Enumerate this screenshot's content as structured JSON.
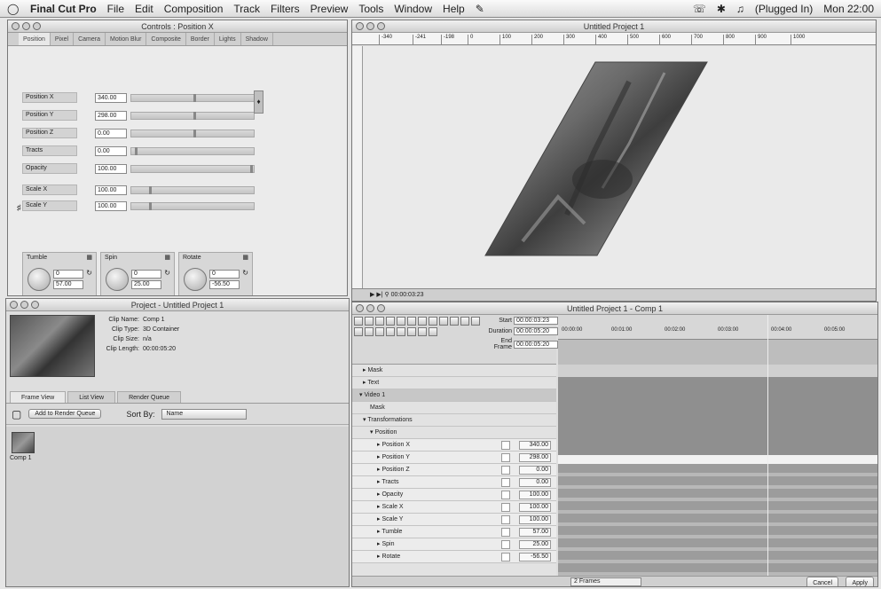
{
  "menubar": {
    "app": "Final Cut Pro",
    "items": [
      "File",
      "Edit",
      "Composition",
      "Track",
      "Filters",
      "Preview",
      "Tools",
      "Window",
      "Help"
    ],
    "status": "(Plugged In)",
    "clock": "Mon 22:00"
  },
  "controls": {
    "title": "Controls : Position X",
    "tabs": [
      "Position",
      "Pixel",
      "Camera",
      "Motion Blur",
      "Composite",
      "Border",
      "Lights",
      "Shadow"
    ],
    "params": [
      {
        "label": "Position X",
        "value": "340.00"
      },
      {
        "label": "Position Y",
        "value": "298.00"
      },
      {
        "label": "Position Z",
        "value": "0.00"
      },
      {
        "label": "Tracts",
        "value": "0.00"
      },
      {
        "label": "Opacity",
        "value": "100.00"
      },
      {
        "label": "Scale X",
        "value": "100.00"
      },
      {
        "label": "Scale Y",
        "value": "100.00"
      }
    ],
    "dials": [
      {
        "label": "Tumble",
        "v1": "0",
        "v2": "57.00"
      },
      {
        "label": "Spin",
        "v1": "0",
        "v2": "25.00"
      },
      {
        "label": "Rotate",
        "v1": "0",
        "v2": "-56.50"
      }
    ]
  },
  "canvas": {
    "title": "Untitled Project 1",
    "ruler": [
      "-340",
      "-241",
      "-198",
      "0",
      "100",
      "200",
      "300",
      "400",
      "500",
      "600",
      "700",
      "800",
      "900",
      "1000"
    ],
    "timecode": "00:00:03:23"
  },
  "project": {
    "title": "Project - Untitled Project 1",
    "clip_keys": [
      "Clip Name:",
      "Clip Type:",
      "Clip Size:",
      "Clip Length:"
    ],
    "clip_values": [
      "Comp 1",
      "3D Container",
      "n/a",
      "00:00:05:20"
    ],
    "tabs": [
      "Frame View",
      "List View",
      "Render Queue"
    ],
    "add_button": "Add to Render Queue",
    "sort_label": "Sort By:",
    "sort_value": "Name",
    "item": "Comp 1"
  },
  "timeline": {
    "title": "Untitled Project 1 - Comp 1",
    "start_label": "Start",
    "start_value": "00:00:03:23",
    "duration_label": "Duration",
    "duration_value": "00:00:05:20",
    "end_label": "End Frame",
    "end_value": "00:00:05:20",
    "ruler": [
      "00:00:00",
      "00:01:00",
      "00:02:00",
      "00:03:00",
      "00:04:00",
      "00:05:00"
    ],
    "layers": [
      {
        "label": "Mask",
        "value": "",
        "cls": "indent1"
      },
      {
        "label": "Text",
        "value": "",
        "cls": "indent1"
      },
      {
        "label": "Video 1",
        "value": "",
        "cls": "dark"
      },
      {
        "label": "Mask",
        "value": "",
        "cls": "indent2"
      },
      {
        "label": "Transformations",
        "value": "",
        "cls": "indent1"
      },
      {
        "label": "Position",
        "value": "",
        "cls": "indent2"
      },
      {
        "label": "Position X",
        "value": "340.00",
        "cls": "indent3"
      },
      {
        "label": "Position Y",
        "value": "298.00",
        "cls": "indent3"
      },
      {
        "label": "Position Z",
        "value": "0.00",
        "cls": "indent3"
      },
      {
        "label": "Tracts",
        "value": "0.00",
        "cls": "indent3"
      },
      {
        "label": "Opacity",
        "value": "100.00",
        "cls": "indent3"
      },
      {
        "label": "Scale X",
        "value": "100.00",
        "cls": "indent3"
      },
      {
        "label": "Scale Y",
        "value": "100.00",
        "cls": "indent3"
      },
      {
        "label": "Tumble",
        "value": "57.00",
        "cls": "indent3"
      },
      {
        "label": "Spin",
        "value": "25.00",
        "cls": "indent3"
      },
      {
        "label": "Rotate",
        "value": "-56.50",
        "cls": "indent3"
      }
    ],
    "bottom_select": "2 Frames",
    "cancel": "Cancel",
    "apply": "Apply"
  }
}
